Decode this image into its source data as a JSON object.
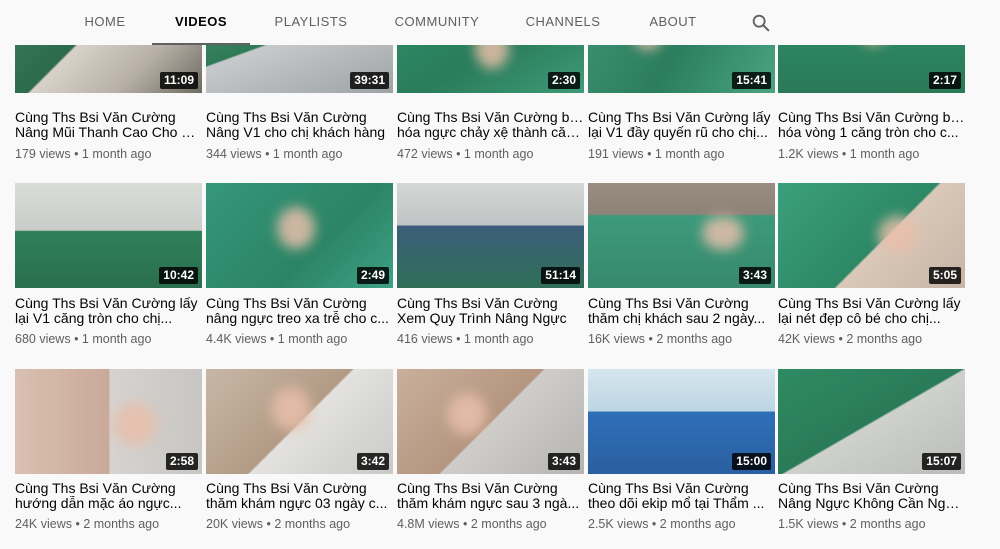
{
  "tabs": [
    {
      "label": "HOME",
      "active": false
    },
    {
      "label": "VIDEOS",
      "active": true
    },
    {
      "label": "PLAYLISTS",
      "active": false
    },
    {
      "label": "COMMUNITY",
      "active": false
    },
    {
      "label": "CHANNELS",
      "active": false
    },
    {
      "label": "ABOUT",
      "active": false
    }
  ],
  "search_icon": "search-icon",
  "colors": {
    "accent": "#606060",
    "scrubs": "#2f8a5b",
    "text": "#030303",
    "meta": "#606060",
    "duration_bg": "#000000"
  },
  "videos": [
    {
      "duration": "11:09",
      "title_line1": "Cùng Ths Bsi Văn Cường",
      "title_line2": "Nâng Mũi Thanh Cao Cho C...",
      "views": "179 views",
      "age": "1 month ago"
    },
    {
      "duration": "39:31",
      "title_line1": "Cùng Ths Bsi Văn Cường",
      "title_line2": "Nâng V1 cho chị khách hàng",
      "views": "344 views",
      "age": "1 month ago"
    },
    {
      "duration": "2:30",
      "title_line1": "Cùng Ths Bsi Văn Cường biến",
      "title_line2": "hóa ngực chảy xệ thành căn...",
      "views": "472 views",
      "age": "1 month ago"
    },
    {
      "duration": "15:41",
      "title_line1": "Cùng Ths Bsi Văn Cường lấy",
      "title_line2": "lại V1 đầy quyến rũ cho chị...",
      "views": "191 views",
      "age": "1 month ago"
    },
    {
      "duration": "2:17",
      "title_line1": "Cùng Ths Bsi Văn Cường biến",
      "title_line2": "hóa vòng 1 căng tròn cho c...",
      "views": "1.2K views",
      "age": "1 month ago"
    },
    {
      "duration": "10:42",
      "title_line1": "Cùng Ths Bsi Văn Cường lấy",
      "title_line2": "lại V1 căng tròn cho chị...",
      "views": "680 views",
      "age": "1 month ago"
    },
    {
      "duration": "2:49",
      "title_line1": "Cùng Ths Bsi Văn Cường",
      "title_line2": "nâng ngực treo xa trễ cho c...",
      "views": "4.4K views",
      "age": "1 month ago"
    },
    {
      "duration": "51:14",
      "title_line1": "Cùng Ths Bsi Văn Cường",
      "title_line2": "Xem Quy Trình Nâng Ngực",
      "views": "416 views",
      "age": "1 month ago"
    },
    {
      "duration": "3:43",
      "title_line1": "Cùng Ths Bsi Văn Cường",
      "title_line2": "thăm chị khách sau 2 ngày...",
      "views": "16K views",
      "age": "2 months ago"
    },
    {
      "duration": "5:05",
      "title_line1": "Cùng Ths Bsi Văn Cường lấy",
      "title_line2": "lại nét đẹp cô bé cho chị...",
      "views": "42K views",
      "age": "2 months ago"
    },
    {
      "duration": "2:58",
      "title_line1": "Cùng Ths Bsi Văn Cường",
      "title_line2": "hướng dẫn mặc áo ngực...",
      "views": "24K views",
      "age": "2 months ago"
    },
    {
      "duration": "3:42",
      "title_line1": "Cùng Ths Bsi Văn Cường",
      "title_line2": "thăm khám ngực 03 ngày c...",
      "views": "20K views",
      "age": "2 months ago"
    },
    {
      "duration": "3:43",
      "title_line1": "Cùng Ths Bsi Văn Cường",
      "title_line2": "thăm khám ngực sau 3 ngà...",
      "views": "4.8M views",
      "age": "2 months ago"
    },
    {
      "duration": "15:00",
      "title_line1": "Cùng Ths Bsi Văn Cường",
      "title_line2": "theo dõi ekip mổ tại Thẩm ...",
      "views": "2.5K views",
      "age": "2 months ago"
    },
    {
      "duration": "15:07",
      "title_line1": "Cùng Ths Bsi Văn Cường",
      "title_line2": "Nâng Ngực Không Cần Nghỉ...",
      "views": "1.5K views",
      "age": "2 months ago"
    }
  ]
}
